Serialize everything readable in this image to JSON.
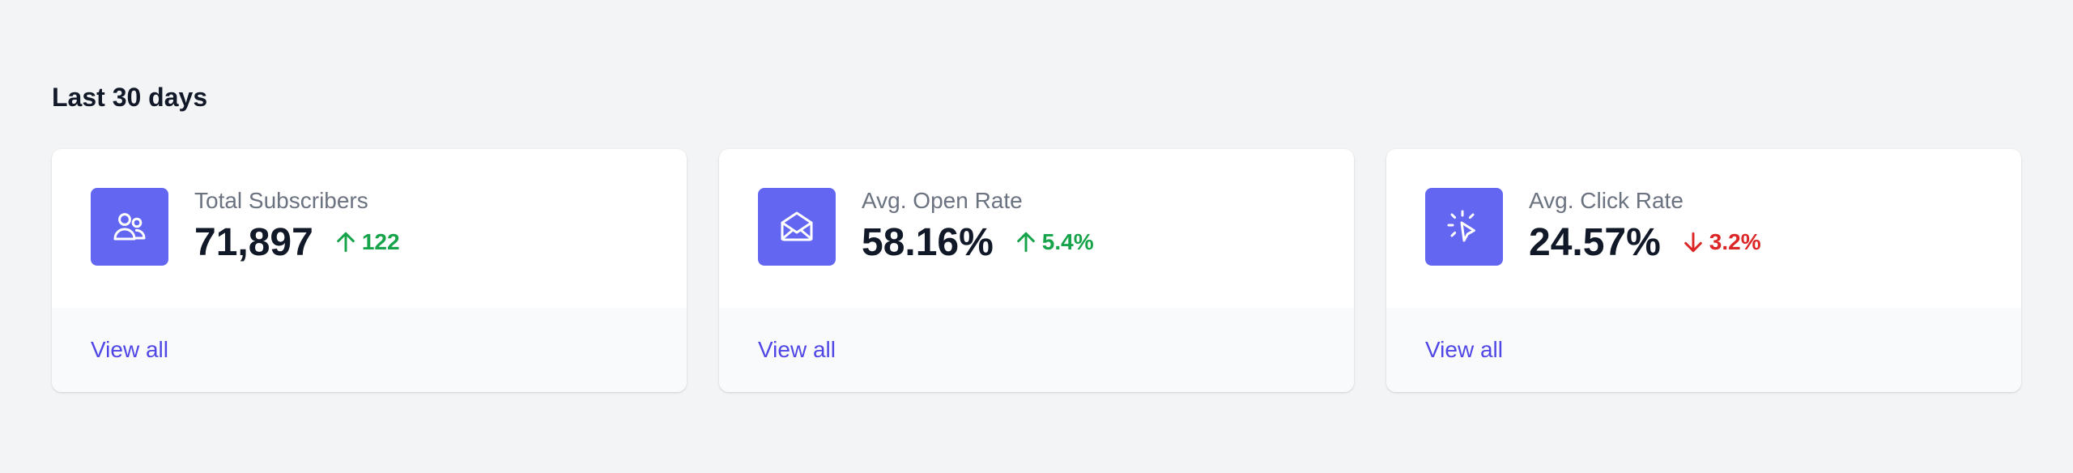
{
  "section": {
    "title": "Last 30 days"
  },
  "colors": {
    "background": "#f3f4f6",
    "icon_bg": "#6366f1",
    "link": "#4f46e5",
    "increase": "#16a34a",
    "decrease": "#dc2626"
  },
  "cards": [
    {
      "icon": "users-icon",
      "label": "Total Subscribers",
      "value": "71,897",
      "change": "122",
      "change_direction": "increase",
      "link": "View all"
    },
    {
      "icon": "envelope-open-icon",
      "label": "Avg. Open Rate",
      "value": "58.16%",
      "change": "5.4%",
      "change_direction": "increase",
      "link": "View all"
    },
    {
      "icon": "cursor-click-icon",
      "label": "Avg. Click Rate",
      "value": "24.57%",
      "change": "3.2%",
      "change_direction": "decrease",
      "link": "View all"
    }
  ]
}
